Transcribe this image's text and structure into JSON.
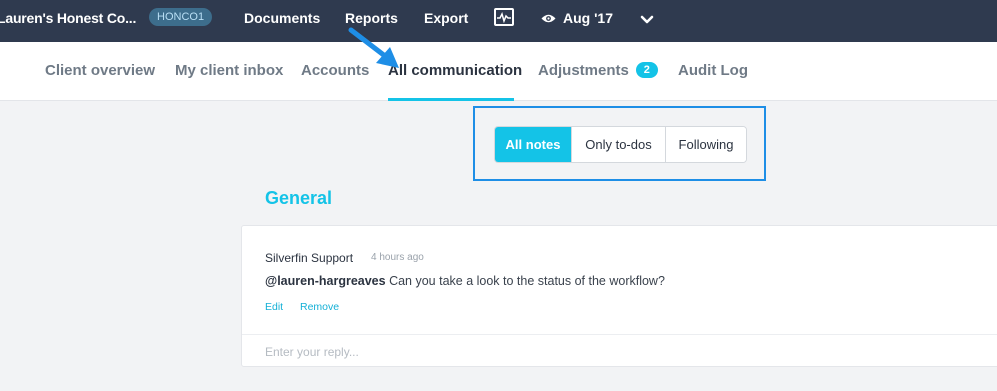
{
  "topbar": {
    "client_name": "Lauren's Honest Co...",
    "client_code": "HONCO1",
    "nav": [
      "Documents",
      "Reports",
      "Export"
    ],
    "chart_icon": "chart-icon",
    "eye_icon": "eye-icon",
    "period": "Aug '17",
    "chevron_icon": "chevron-down-icon"
  },
  "tabs": [
    {
      "label": "Client overview"
    },
    {
      "label": "My client inbox"
    },
    {
      "label": "Accounts"
    },
    {
      "label": "All communication",
      "active": true
    },
    {
      "label": "Adjustments",
      "badge": "2"
    },
    {
      "label": "Audit Log"
    }
  ],
  "filters": [
    {
      "label": "All notes",
      "active": true
    },
    {
      "label": "Only to-dos"
    },
    {
      "label": "Following"
    }
  ],
  "section": {
    "title": "General"
  },
  "note": {
    "author": "Silverfin Support",
    "time": "4 hours ago",
    "mention": "@lauren-hargreaves",
    "message": "Can you take a look to the status of the workflow?",
    "edit_label": "Edit",
    "remove_label": "Remove",
    "reply_placeholder": "Enter your reply..."
  },
  "colors": {
    "topbar_bg": "#2f3a4f",
    "accent": "#14c3e7",
    "highlight_border": "#1e8ee6"
  }
}
